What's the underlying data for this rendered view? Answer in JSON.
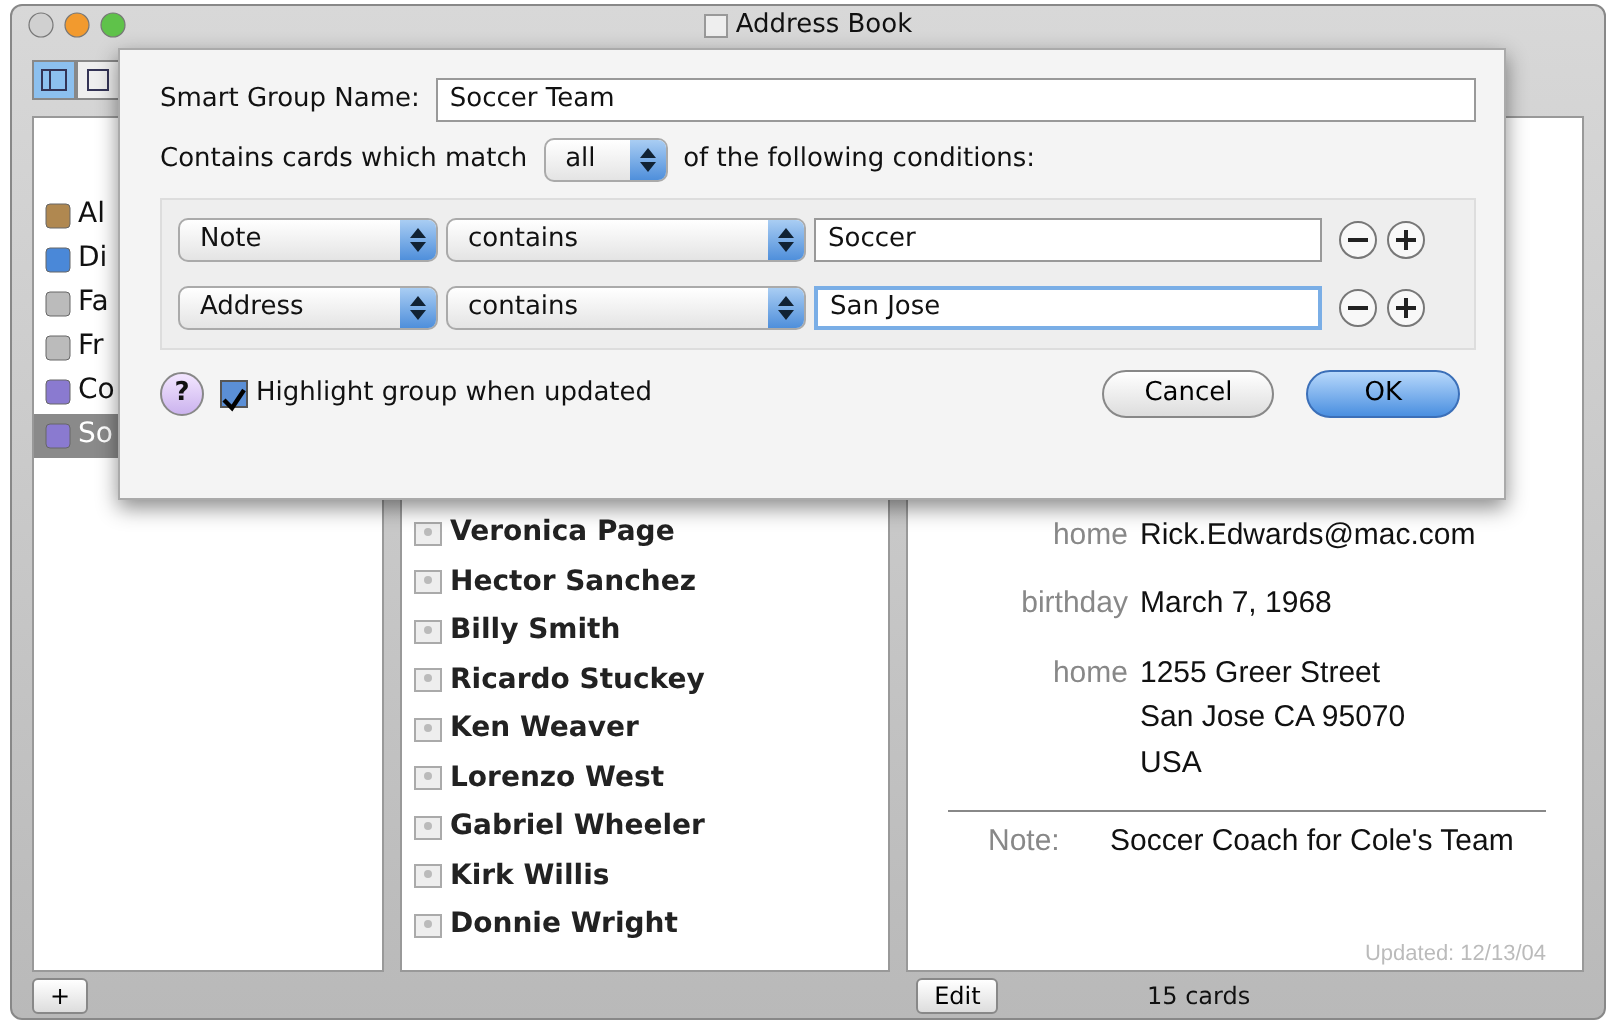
{
  "window": {
    "title": "Address Book"
  },
  "toolbar": {
    "view_buttons": [
      {
        "kind": "columns",
        "selected": true
      },
      {
        "kind": "card",
        "selected": false
      }
    ]
  },
  "groups": [
    {
      "label": "Al",
      "kind": "all",
      "selected": false
    },
    {
      "label": "Di",
      "kind": "directory",
      "selected": false
    },
    {
      "label": "Fa",
      "kind": "group",
      "selected": false
    },
    {
      "label": "Fr",
      "kind": "group",
      "selected": false
    },
    {
      "label": "Co",
      "kind": "smart",
      "selected": false
    },
    {
      "label": "So",
      "kind": "smart",
      "selected": true
    }
  ],
  "names": [
    "Veronica Page",
    "Hector Sanchez",
    "Billy Smith",
    "Ricardo Stuckey",
    "Ken Weaver",
    "Lorenzo West",
    "Gabriel Wheeler",
    "Kirk Willis",
    "Donnie Wright"
  ],
  "card": {
    "fields": [
      {
        "label": "home",
        "lines": [
          "Rick.Edwards@mac.com"
        ]
      },
      {
        "label": "birthday",
        "lines": [
          "March 7, 1968"
        ]
      },
      {
        "label": "home",
        "lines": [
          "1255 Greer Street",
          "San Jose CA 95070",
          "USA"
        ]
      }
    ],
    "note_label": "Note:",
    "note": "Soccer Coach for Cole's Team",
    "updated": "Updated: 12/13/04"
  },
  "bottom_bar": {
    "add": "+",
    "edit": "Edit",
    "count": "15 cards"
  },
  "sheet": {
    "name_label": "Smart Group Name:",
    "name_value": "Soccer Team",
    "match_prefix": "Contains cards which match",
    "match_value": "all",
    "match_suffix": "of the following conditions:",
    "conditions": [
      {
        "field": "Note",
        "operator": "contains",
        "value": "Soccer",
        "focused": false
      },
      {
        "field": "Address",
        "operator": "contains",
        "value": "San Jose",
        "focused": true
      }
    ],
    "help": "?",
    "highlight": {
      "label": "Highlight group when updated",
      "checked": true
    },
    "buttons": [
      {
        "label": "Cancel",
        "default": false
      },
      {
        "label": "OK",
        "default": true
      }
    ]
  }
}
